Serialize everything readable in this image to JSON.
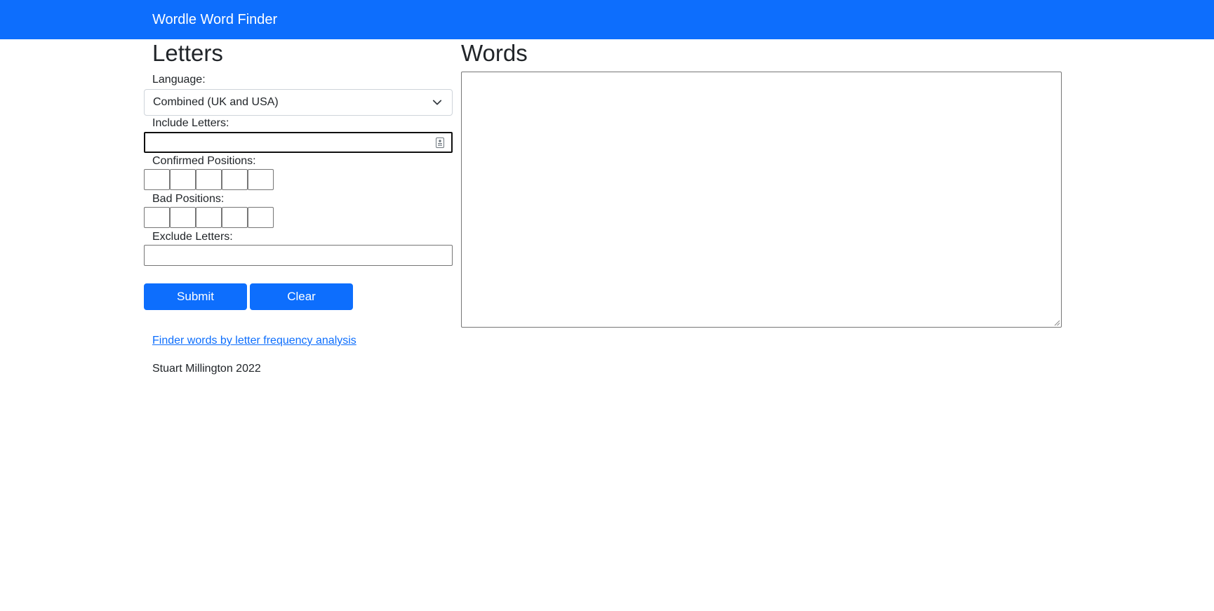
{
  "navbar": {
    "brand": "Wordle Word Finder"
  },
  "letters_panel": {
    "heading": "Letters",
    "language_label": "Language:",
    "language_selected": "Combined (UK and USA)",
    "include_label": "Include Letters:",
    "include_value": "",
    "confirmed_label": "Confirmed Positions:",
    "confirmed_values": [
      "",
      "",
      "",
      "",
      ""
    ],
    "bad_label": "Bad Positions:",
    "bad_values": [
      "",
      "",
      "",
      "",
      ""
    ],
    "exclude_label": "Exclude Letters:",
    "exclude_value": "",
    "submit_label": "Submit",
    "clear_label": "Clear"
  },
  "words_panel": {
    "heading": "Words",
    "value": ""
  },
  "footer": {
    "link_text": "Finder words by letter frequency analysis",
    "credit": "Stuart Millington 2022"
  },
  "colors": {
    "primary": "#0d6efd",
    "text": "#212529"
  },
  "icons": {
    "select_chevron": "chevron-down-icon",
    "autofill": "contact-card-icon"
  }
}
